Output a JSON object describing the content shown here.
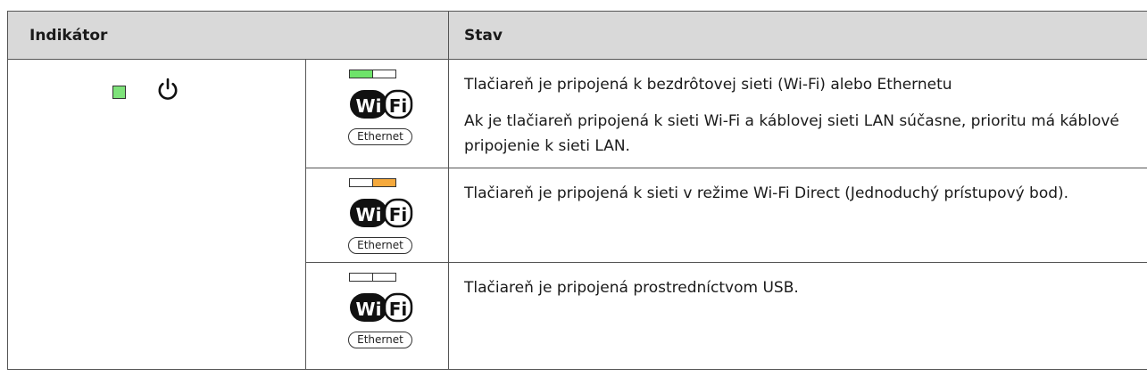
{
  "table": {
    "headers": {
      "indikator": "Indikátor",
      "stav": "Stav"
    },
    "indicator": {
      "light_color": "#7ee27a",
      "power_icon": "power-icon"
    },
    "icon_labels": {
      "wifi_left": "Wi",
      "wifi_right": "Fi",
      "ethernet": "Ethernet"
    },
    "led_colors": {
      "green": "#6ee36a",
      "orange": "#f5a93c",
      "off": "#ffffff"
    },
    "rows": [
      {
        "leds": [
          "green",
          "off"
        ],
        "lines": [
          "Tlačiareň je pripojená k bezdrôtovej sieti (Wi-Fi) alebo Ethernetu",
          "Ak je tlačiareň pripojená k sieti Wi-Fi a káblovej sieti LAN súčasne, prioritu má káblové pripojenie k sieti LAN."
        ]
      },
      {
        "leds": [
          "off",
          "orange"
        ],
        "lines": [
          "Tlačiareň je pripojená k sieti v režime Wi-Fi Direct (Jednoduchý prístupový bod)."
        ]
      },
      {
        "leds": [
          "off",
          "off"
        ],
        "lines": [
          "Tlačiareň je pripojená prostredníctvom USB."
        ]
      }
    ]
  }
}
